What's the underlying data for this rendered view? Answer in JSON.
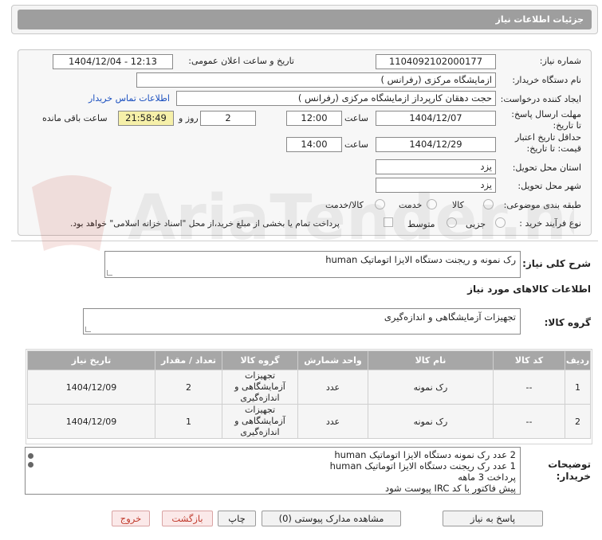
{
  "header": {
    "title": "جزئیات اطلاعات نیاز"
  },
  "fields": {
    "need_number_label": "شماره نیاز:",
    "need_number": "1104092102000177",
    "announce_label": "تاریخ و ساعت اعلان عمومی:",
    "announce_value": "1404/12/04 - 12:13",
    "buyer_label": "نام دستگاه خریدار:",
    "buyer_value": "ازمایشگاه مرکزی (رفرانس )",
    "creator_label": "ایجاد کننده درخواست:",
    "creator_value": "حجت دهقان کارپرداز ازمایشگاه مرکزی (رفرانس )",
    "contact_link": "اطلاعات تماس خریدار",
    "deadline_label": "مهلت ارسال پاسخ: تا تاریخ:",
    "deadline_date": "1404/12/07",
    "time_label": "ساعت",
    "deadline_time": "12:00",
    "days_value": "2",
    "days_label": "روز و",
    "remaining_value": "21:58:49",
    "remaining_label": "ساعت باقی مانده",
    "validity_label": "حداقل تاریخ اعتبار قیمت: تا تاریخ:",
    "validity_date": "1404/12/29",
    "validity_time": "14:00",
    "province_label": "استان محل تحویل:",
    "province_value": "یزد",
    "city_label": "شهر محل تحویل:",
    "city_value": "یزد",
    "category_label": "طبقه بندی موضوعی:",
    "cat_options": [
      "کالا",
      "خدمت",
      "کالا/خدمت"
    ],
    "process_label": "نوع فرآیند خرید :",
    "process_options": [
      "جزیی",
      "متوسط"
    ],
    "payment_note": "پرداخت تمام یا بخشی از مبلغ خرید،از محل \"اسناد خزانه اسلامی\" خواهد بود."
  },
  "summary": {
    "label": "شرح کلی نیاز:",
    "value": "رک نمونه و ریجنت دستگاه الایزا اتوماتیک human"
  },
  "goods_info_title": "اطلاعات کالاهای مورد نیاز",
  "goods_group": {
    "label": "گروه کالا:",
    "value": "تجهیزات آزمایشگاهی و اندازه‌گیری"
  },
  "table": {
    "headers": [
      "ردیف",
      "کد کالا",
      "نام کالا",
      "واحد شمارش",
      "گروه کالا",
      "تعداد / مقدار",
      "تاریخ نیاز"
    ],
    "rows": [
      [
        "1",
        "--",
        "رک نمونه",
        "عدد",
        "تجهیزات آزمایشگاهی و اندازه‌گیری",
        "2",
        "1404/12/09"
      ],
      [
        "2",
        "--",
        "رک نمونه",
        "عدد",
        "تجهیزات آزمایشگاهی و اندازه‌گیری",
        "1",
        "1404/12/09"
      ]
    ]
  },
  "buyer_notes": {
    "label": "توضیحات خریدار:",
    "lines": [
      "2 عدد رک نمونه دستگاه الایزا اتوماتیک human",
      "1 عدد رک ریجنت دستگاه الایزا اتوماتیک human",
      "پرداخت 3 ماهه",
      "پیش فاکتور با کد IRC پیوست شود"
    ]
  },
  "buttons": {
    "reply": "پاسخ به نیاز",
    "attachments": "مشاهده مدارک پیوستی (0)",
    "print": "چاپ",
    "back": "بازگشت",
    "exit": "خروج"
  },
  "watermark": "AriaTender.net",
  "colors": {
    "title_bar": "#9e9e9e",
    "link": "#1a4fbf",
    "remaining_bg": "#f6f0a9",
    "exit_text": "#c0392b"
  }
}
